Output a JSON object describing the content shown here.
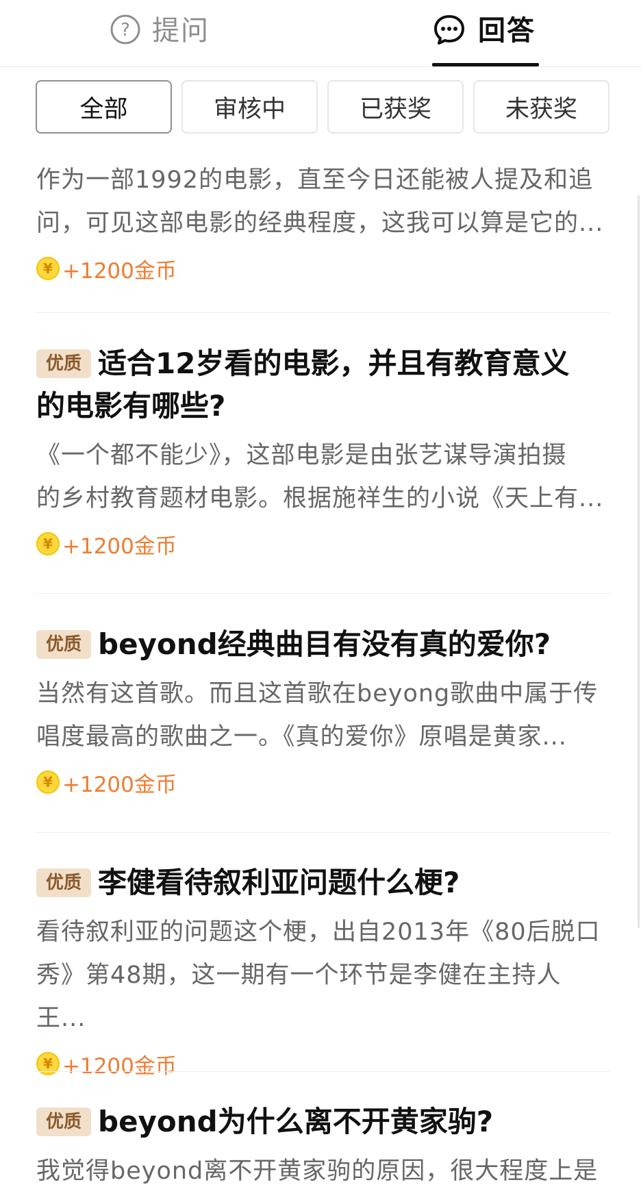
{
  "tabs": {
    "ask_label": "提问",
    "answer_label": "回答",
    "ask_icon": "question-circle-icon",
    "answer_icon": "chat-bubble-icon"
  },
  "filters": [
    "全部",
    "审核中",
    "已获奖",
    "未获奖"
  ],
  "active_filter": "全部",
  "badge_label": "优质",
  "items": [
    {
      "title": "",
      "excerpt_line1": "作为一部1992的电影，直至今日还能被人提及和追",
      "excerpt_line2": "问，可见这部电影的经典程度，这我可以算是它的...",
      "reward": "+1200金币"
    },
    {
      "title_line1": "适合12岁看的电影，并且有教育意义",
      "title_line2": "的电影有哪些?",
      "excerpt_line1": "《一个都不能少》，这部电影是由张艺谋导演拍摄",
      "excerpt_line2": "的乡村教育题材电影。根据施祥生的小说《天上有...",
      "reward": "+1200金币"
    },
    {
      "title": "beyond经典曲目有没有真的爱你?",
      "excerpt_line1": "当然有这首歌。而且这首歌在beyong歌曲中属于传",
      "excerpt_line2": "唱度最高的歌曲之一。《真的爱你》原唱是黄家...",
      "reward": "+1200金币"
    },
    {
      "title": "李健看待叙利亚问题什么梗?",
      "excerpt_line1": "看待叙利亚的问题这个梗，出自2013年《80后脱口",
      "excerpt_line2": "秀》第48期，这一期有一个环节是李健在主持人王...",
      "reward": "+1200金币"
    },
    {
      "title": "beyond为什么离不开黄家驹?",
      "excerpt_line1": "我觉得beyond离不开黄家驹的原因，很大程度上是"
    }
  ],
  "colors": {
    "reward": "#ed7d31",
    "badge_bg": "#f2dfca",
    "badge_text": "#8a5a2b",
    "coin": "#ffd83d"
  }
}
